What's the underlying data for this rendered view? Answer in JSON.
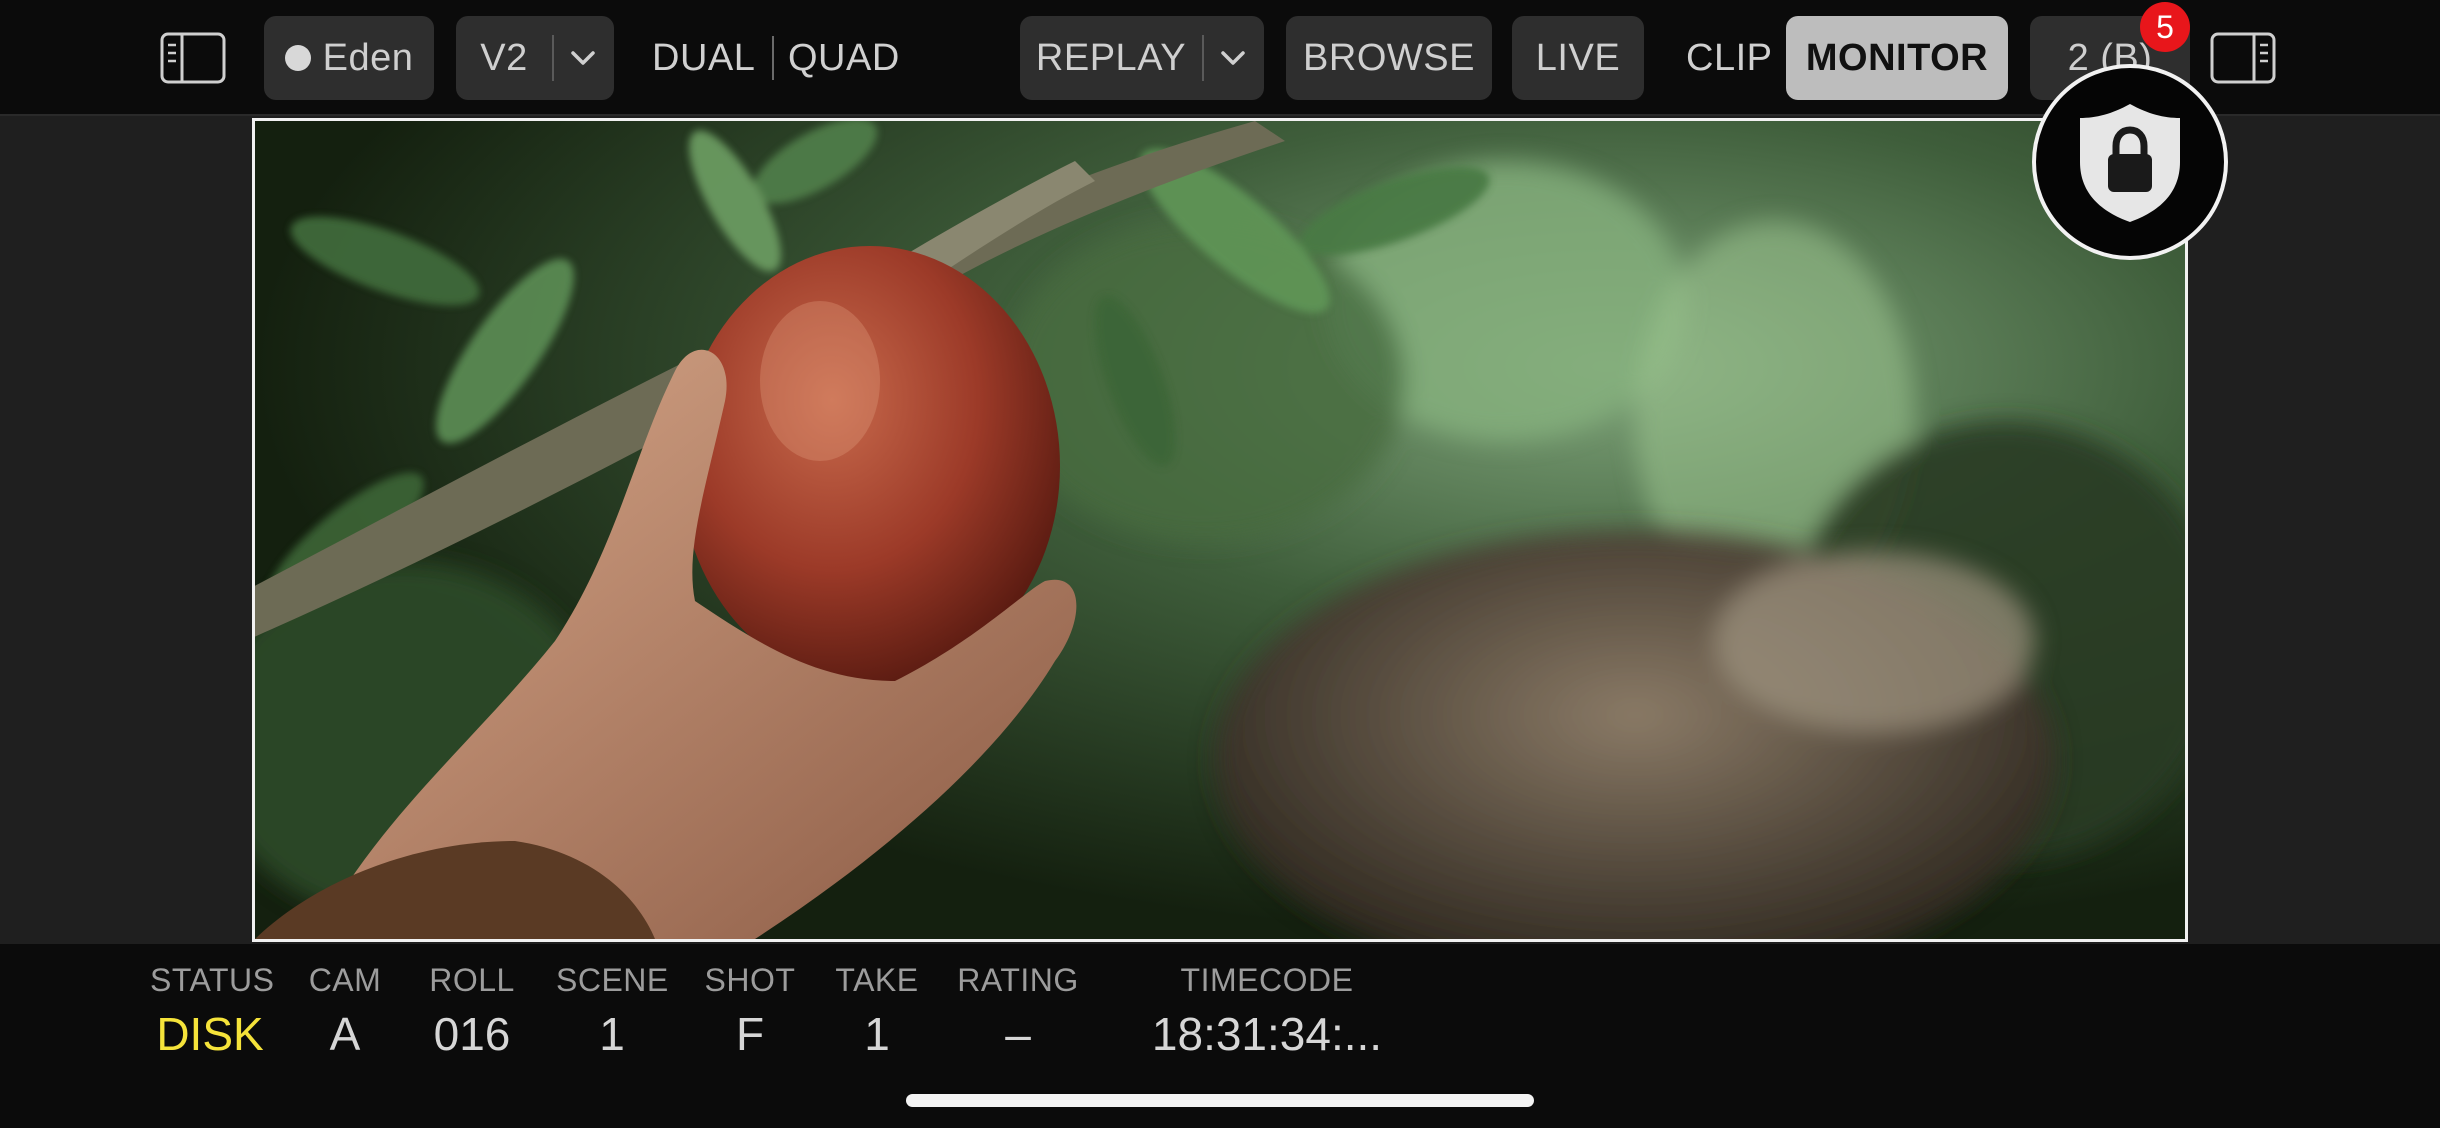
{
  "toolbar": {
    "device": "Eden",
    "view": "V2",
    "dual": "DUAL",
    "quad": "QUAD",
    "replay": "REPLAY",
    "browse": "BROWSE",
    "live": "LIVE",
    "clip": "CLIP",
    "monitor": "MONITOR",
    "channel": "2 (B)",
    "notification_count": "5"
  },
  "metadata": {
    "status": {
      "label": "STATUS",
      "value": "DISK"
    },
    "cam": {
      "label": "CAM",
      "value": "A"
    },
    "roll": {
      "label": "ROLL",
      "value": "016"
    },
    "scene": {
      "label": "SCENE",
      "value": "1"
    },
    "shot": {
      "label": "SHOT",
      "value": "F"
    },
    "take": {
      "label": "TAKE",
      "value": "1"
    },
    "rating": {
      "label": "RATING",
      "value": "–"
    },
    "timecode": {
      "label": "TIMECODE",
      "value": "18:31:34:..."
    }
  },
  "colors": {
    "status_disk": "#f5e33a",
    "badge": "#e8161b",
    "active_tab": "#bdbdbd"
  },
  "icons": [
    "left-panel-icon",
    "right-panel-icon",
    "chevron-down-icon",
    "lock-shield-icon"
  ]
}
